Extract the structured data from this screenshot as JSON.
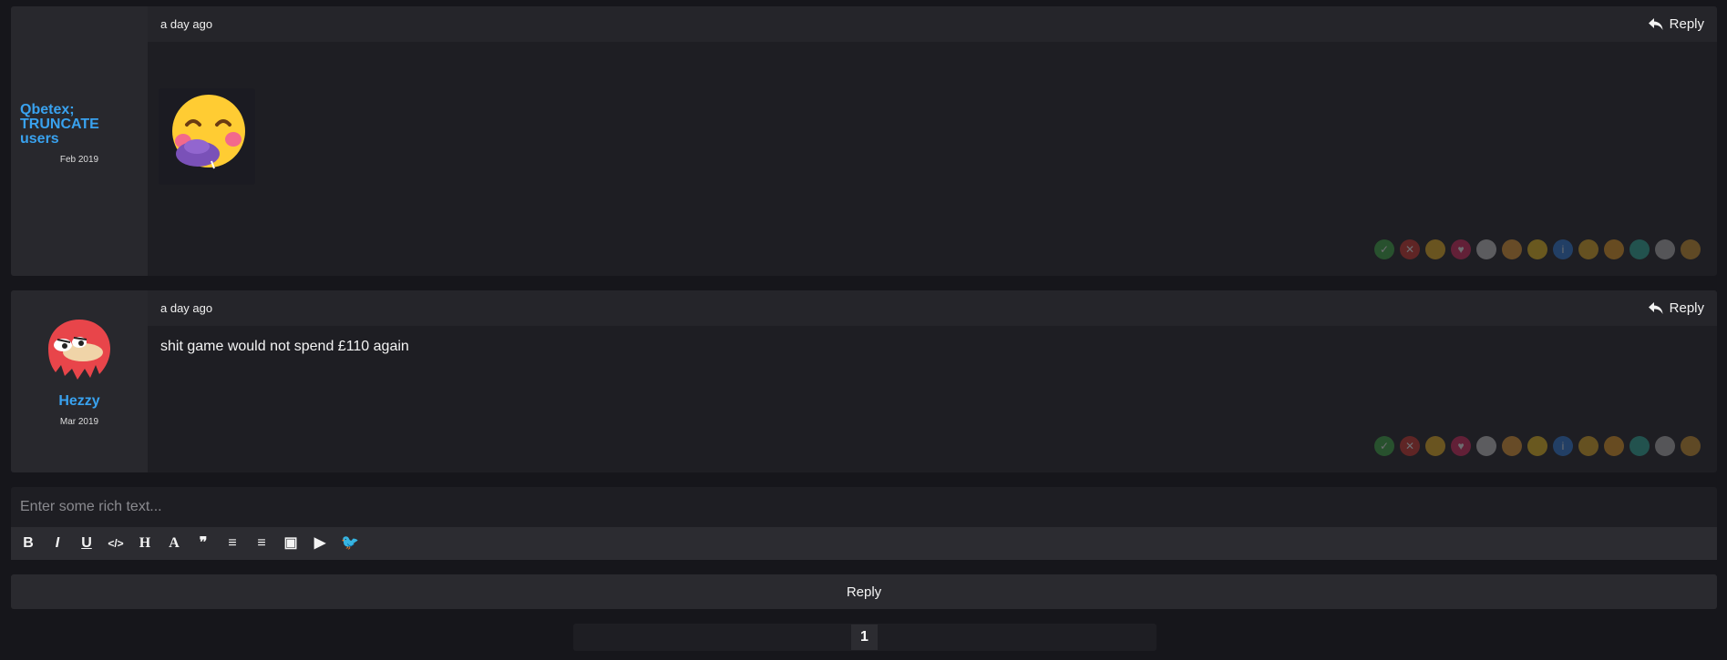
{
  "posts": [
    {
      "timestamp": "a day ago",
      "reply_label": "Reply",
      "username": "Qbetex; TRUNCATE users",
      "joined": "Feb 2019",
      "content_type": "emoji",
      "emoji": "blushing-face-emoji"
    },
    {
      "timestamp": "a day ago",
      "reply_label": "Reply",
      "username": "Hezzy",
      "joined": "Mar 2019",
      "content_type": "text",
      "text": "shit game would not spend £110 again"
    }
  ],
  "reactions": [
    {
      "name": "check-reaction",
      "color": "#3cb043",
      "glyph": "✓"
    },
    {
      "name": "cross-reaction",
      "color": "#d9342b",
      "glyph": "✕"
    },
    {
      "name": "pacman-reaction",
      "color": "#f5b81c",
      "glyph": ""
    },
    {
      "name": "heart-reaction",
      "color": "#e0245e",
      "glyph": "♥"
    },
    {
      "name": "bunny-reaction",
      "color": "#cfcfcf",
      "glyph": ""
    },
    {
      "name": "angry-face-reaction",
      "color": "#f0a030",
      "glyph": ""
    },
    {
      "name": "thinking-face-reaction",
      "color": "#f5c518",
      "glyph": ""
    },
    {
      "name": "info-reaction",
      "color": "#2a7de1",
      "glyph": "i"
    },
    {
      "name": "laugh-face-reaction",
      "color": "#e8b020",
      "glyph": ""
    },
    {
      "name": "award-reaction",
      "color": "#f0a020",
      "glyph": ""
    },
    {
      "name": "glasses-reaction",
      "color": "#2bb3a0",
      "glyph": ""
    },
    {
      "name": "clock-reaction",
      "color": "#bbbbbb",
      "glyph": ""
    },
    {
      "name": "box-reaction",
      "color": "#d99a2b",
      "glyph": ""
    }
  ],
  "composer": {
    "placeholder": "Enter some rich text...",
    "tools": [
      {
        "name": "bold-icon",
        "glyph": "B"
      },
      {
        "name": "italic-icon",
        "glyph": "I"
      },
      {
        "name": "underline-icon",
        "glyph": "U"
      },
      {
        "name": "code-icon",
        "glyph": "</>"
      },
      {
        "name": "heading-icon",
        "glyph": "H"
      },
      {
        "name": "font-icon",
        "glyph": "A"
      },
      {
        "name": "quote-icon",
        "glyph": "❞"
      },
      {
        "name": "ordered-list-icon",
        "glyph": "≡"
      },
      {
        "name": "bullet-list-icon",
        "glyph": "≡"
      },
      {
        "name": "image-icon",
        "glyph": "▣"
      },
      {
        "name": "youtube-icon",
        "glyph": "▶"
      },
      {
        "name": "twitter-icon",
        "glyph": "🐦"
      }
    ],
    "submit_label": "Reply"
  },
  "pagination": {
    "current_page": "1"
  }
}
